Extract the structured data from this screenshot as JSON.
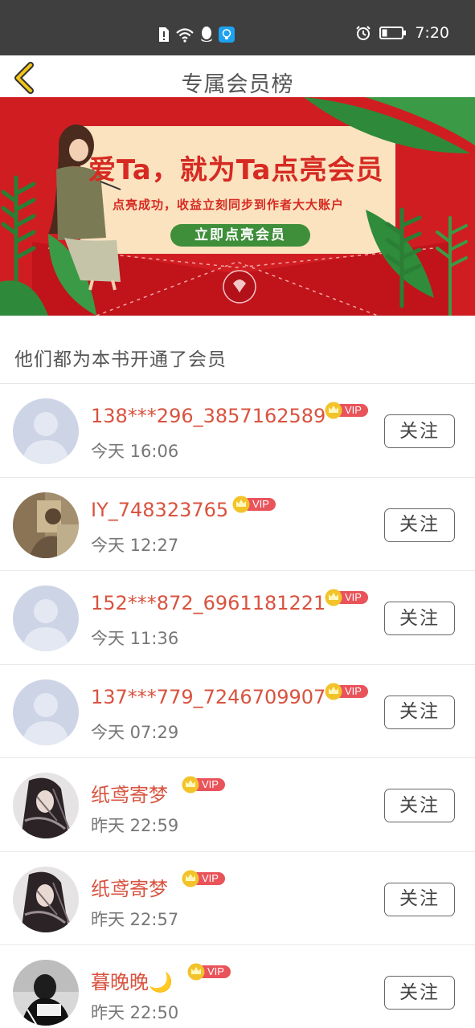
{
  "status_bar": {
    "time": "7:20",
    "icons": [
      "sim-alert-icon",
      "wifi-icon",
      "qq-icon",
      "lightbulb-app-icon",
      "alarm-icon",
      "battery-icon"
    ]
  },
  "header": {
    "title": "专属会员榜",
    "back_icon": "chevron-left-icon"
  },
  "banner": {
    "headline": "爱Ta，就为Ta点亮会员",
    "subline": "点亮成功，收益立刻同步到作者大大账户",
    "cta_label": "立即点亮会员",
    "colors": {
      "background": "#c8161c",
      "card": "#fbe3c0",
      "button": "#3e8e3a"
    }
  },
  "section": {
    "title": "他们都为本书开通了会员"
  },
  "vip_badge_label": "VIP",
  "follow_label": "关注",
  "colors": {
    "accent": "#d9533f",
    "vip": "#e9535a",
    "crown": "#f3c32a"
  },
  "members": [
    {
      "name": "138***296_3857162589",
      "time": "今天 16:06",
      "avatar": "default"
    },
    {
      "name": "IY_748323765",
      "time": "今天 12:27",
      "avatar": "photo"
    },
    {
      "name": "152***872_6961181221",
      "time": "今天 11:36",
      "avatar": "default"
    },
    {
      "name": "137***779_7246709907",
      "time": "今天 07:29",
      "avatar": "default"
    },
    {
      "name": "纸鸢寄梦",
      "time": "昨天 22:59",
      "avatar": "dark"
    },
    {
      "name": "纸鸢寄梦",
      "time": "昨天 22:57",
      "avatar": "dark"
    },
    {
      "name": "暮晚晚🌙",
      "time": "昨天 22:50",
      "avatar": "bw"
    }
  ]
}
